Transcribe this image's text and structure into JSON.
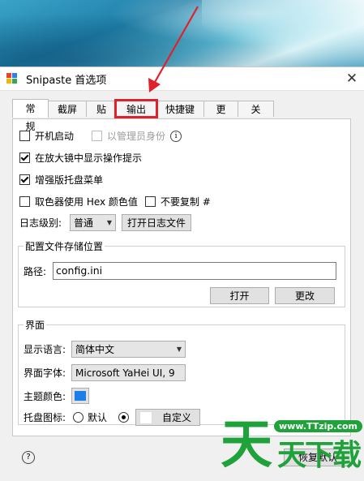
{
  "window": {
    "title": "Snipaste 首选项",
    "close_glyph": "✕"
  },
  "tabs": [
    {
      "label": "常规",
      "active": true
    },
    {
      "label": "截屏"
    },
    {
      "label": "贴图"
    },
    {
      "label": "输出",
      "highlighted": true
    },
    {
      "label": "快捷键"
    },
    {
      "label": "更新"
    },
    {
      "label": "关于"
    }
  ],
  "general": {
    "autostart": {
      "label": "开机启动",
      "checked": false
    },
    "run_as_admin": {
      "label": "以管理员身份",
      "checked": false,
      "disabled": true
    },
    "info_glyph": "i",
    "show_tips": {
      "label": "在放大镜中显示操作提示",
      "checked": true
    },
    "enhanced_tray": {
      "label": "增强版托盘菜单",
      "checked": true
    },
    "hex_color": {
      "label": "取色器使用 Hex 颜色值",
      "checked": false
    },
    "no_copy_hash": {
      "label": "不要复制 #",
      "checked": false
    },
    "log_level": {
      "label": "日志级别:",
      "value": "普通"
    },
    "open_log_button": "打开日志文件"
  },
  "config_location": {
    "title": "配置文件存储位置",
    "path_label": "路径:",
    "path_value": "config.ini",
    "open_button": "打开",
    "change_button": "更改"
  },
  "interface": {
    "title": "界面",
    "language_label": "显示语言:",
    "language_value": "简体中文",
    "font_label": "界面字体:",
    "font_value": "Microsoft YaHei UI, 9",
    "theme_color_label": "主题颜色:",
    "theme_color": "#1e7ee8",
    "tray_icon_label": "托盘图标:",
    "tray_default_label": "默认",
    "tray_default_selected": false,
    "tray_custom_selected": true,
    "custom_button": "自定义"
  },
  "footer": {
    "help_glyph": "?",
    "reset_button": "恢复默认"
  },
  "watermark": {
    "url": "www.TTzip.com",
    "big_char": "天",
    "small_chars": "天下载"
  },
  "colors": {
    "annotation_red": "#e0202a",
    "watermark_green": "#1fa23a"
  }
}
